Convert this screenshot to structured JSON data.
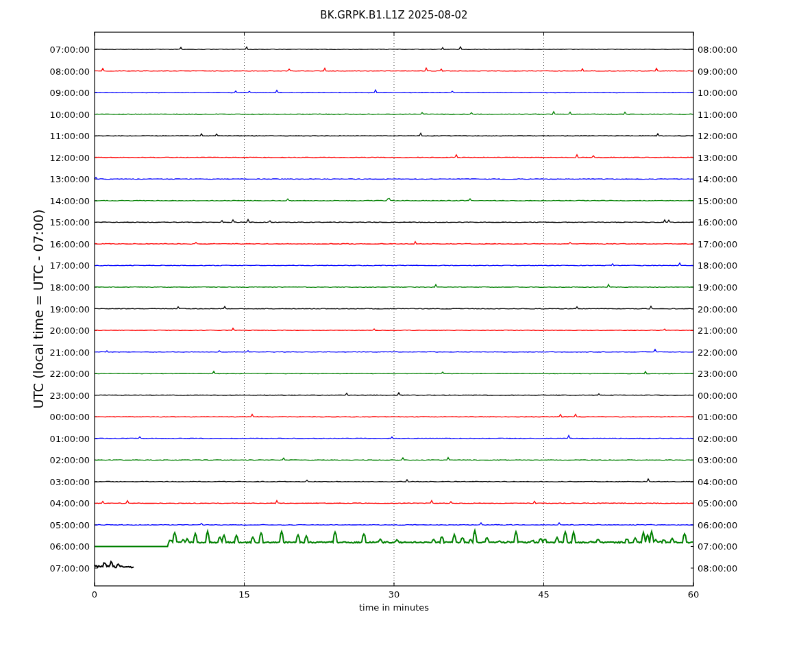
{
  "title": "BK.GRPK.B1.L1Z 2025-08-02",
  "y_axis_title": "UTC (local time = UTC - 07:00)",
  "x_axis_title": "time in minutes",
  "x_ticks": [
    "0",
    "15",
    "30",
    "45",
    "60"
  ],
  "rows": [
    {
      "left": "07:00:00",
      "right": "08:00:00",
      "color": "#000000",
      "kind": "quiet"
    },
    {
      "left": "08:00:00",
      "right": "09:00:00",
      "color": "#ff0000",
      "kind": "quiet"
    },
    {
      "left": "09:00:00",
      "right": "10:00:00",
      "color": "#0000ff",
      "kind": "quiet"
    },
    {
      "left": "10:00:00",
      "right": "11:00:00",
      "color": "#008000",
      "kind": "quiet"
    },
    {
      "left": "11:00:00",
      "right": "12:00:00",
      "color": "#000000",
      "kind": "quiet"
    },
    {
      "left": "12:00:00",
      "right": "13:00:00",
      "color": "#ff0000",
      "kind": "quiet"
    },
    {
      "left": "13:00:00",
      "right": "14:00:00",
      "color": "#0000ff",
      "kind": "quiet"
    },
    {
      "left": "14:00:00",
      "right": "15:00:00",
      "color": "#008000",
      "kind": "quiet"
    },
    {
      "left": "15:00:00",
      "right": "16:00:00",
      "color": "#000000",
      "kind": "quiet"
    },
    {
      "left": "16:00:00",
      "right": "17:00:00",
      "color": "#ff0000",
      "kind": "quiet"
    },
    {
      "left": "17:00:00",
      "right": "18:00:00",
      "color": "#0000ff",
      "kind": "quiet"
    },
    {
      "left": "18:00:00",
      "right": "19:00:00",
      "color": "#008000",
      "kind": "quiet"
    },
    {
      "left": "19:00:00",
      "right": "20:00:00",
      "color": "#000000",
      "kind": "quiet"
    },
    {
      "left": "20:00:00",
      "right": "21:00:00",
      "color": "#ff0000",
      "kind": "quiet"
    },
    {
      "left": "21:00:00",
      "right": "22:00:00",
      "color": "#0000ff",
      "kind": "quiet"
    },
    {
      "left": "22:00:00",
      "right": "23:00:00",
      "color": "#008000",
      "kind": "quiet"
    },
    {
      "left": "23:00:00",
      "right": "00:00:00",
      "color": "#000000",
      "kind": "quiet"
    },
    {
      "left": "00:00:00",
      "right": "01:00:00",
      "color": "#ff0000",
      "kind": "quiet"
    },
    {
      "left": "01:00:00",
      "right": "02:00:00",
      "color": "#0000ff",
      "kind": "quiet"
    },
    {
      "left": "02:00:00",
      "right": "03:00:00",
      "color": "#008000",
      "kind": "quiet"
    },
    {
      "left": "03:00:00",
      "right": "04:00:00",
      "color": "#000000",
      "kind": "quiet"
    },
    {
      "left": "04:00:00",
      "right": "05:00:00",
      "color": "#ff0000",
      "kind": "quiet"
    },
    {
      "left": "05:00:00",
      "right": "06:00:00",
      "color": "#0000ff",
      "kind": "quiet"
    },
    {
      "left": "06:00:00",
      "right": "07:00:00",
      "color": "#008000",
      "kind": "active"
    },
    {
      "left": "07:00:00",
      "right": "08:00:00",
      "color": "#000000",
      "kind": "partial"
    }
  ]
}
